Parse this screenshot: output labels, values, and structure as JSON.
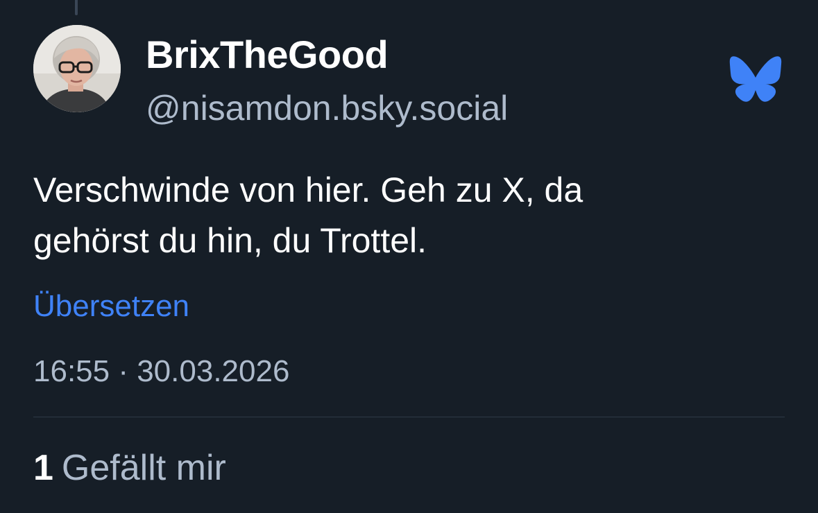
{
  "post": {
    "author": {
      "display_name": "BrixTheGood",
      "handle": "@nisamdon.bsky.social"
    },
    "text_lines": [
      "Verschwinde von hier. Geh zu X, da",
      "gehörst du hin, du Trottel."
    ],
    "translate_label": "Übersetzen",
    "timestamp": "16:55 · 30.03.2026",
    "likes": {
      "count": "1",
      "label": "Gefällt mir"
    }
  },
  "icons": {
    "brand": "bluesky-butterfly-icon"
  },
  "colors": {
    "background": "#161e27",
    "text_primary": "#ffffff",
    "text_secondary": "#aebbcc",
    "link": "#3f82f7",
    "brand": "#3f82f7"
  }
}
